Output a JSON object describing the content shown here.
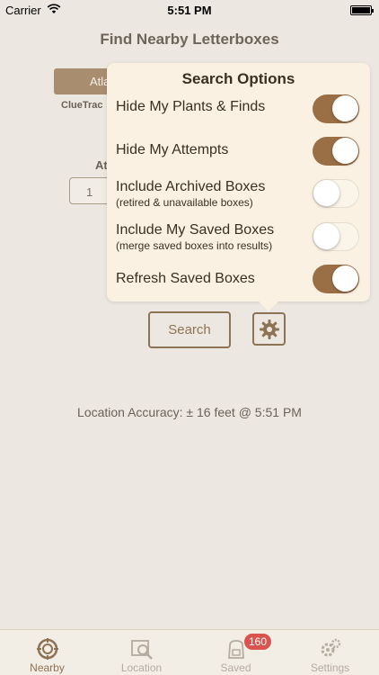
{
  "status": {
    "carrier": "Carrier",
    "time": "5:51 PM"
  },
  "nav": {
    "title": "Find Nearby Letterboxes"
  },
  "background_controls": {
    "segment_label": "Atla",
    "source_label": "ClueTrac",
    "at_label": "At",
    "count_value": "1"
  },
  "search_button_label": "Search",
  "location_accuracy": "Location Accuracy: ± 16 feet @ 5:51 PM",
  "popover": {
    "title": "Search Options",
    "options": [
      {
        "label": "Hide My Plants & Finds",
        "sublabel": "",
        "on": true
      },
      {
        "label": "Hide My Attempts",
        "sublabel": "",
        "on": true
      },
      {
        "label": "Include Archived Boxes",
        "sublabel": "(retired & unavailable boxes)",
        "on": false
      },
      {
        "label": "Include My Saved Boxes",
        "sublabel": "(merge saved boxes into results)",
        "on": false
      },
      {
        "label": "Refresh Saved Boxes",
        "sublabel": "",
        "on": true
      }
    ]
  },
  "tabs": [
    {
      "label": "Nearby",
      "icon": "compass-icon",
      "active": true
    },
    {
      "label": "Location",
      "icon": "map-search-icon",
      "active": false
    },
    {
      "label": "Saved",
      "icon": "backpack-icon",
      "active": false,
      "badge": "160"
    },
    {
      "label": "Settings",
      "icon": "gears-icon",
      "active": false
    }
  ],
  "colors": {
    "accent": "#9b6f46",
    "background": "#ece8e1",
    "popover": "#faf1e2",
    "badge": "#d9534f"
  }
}
